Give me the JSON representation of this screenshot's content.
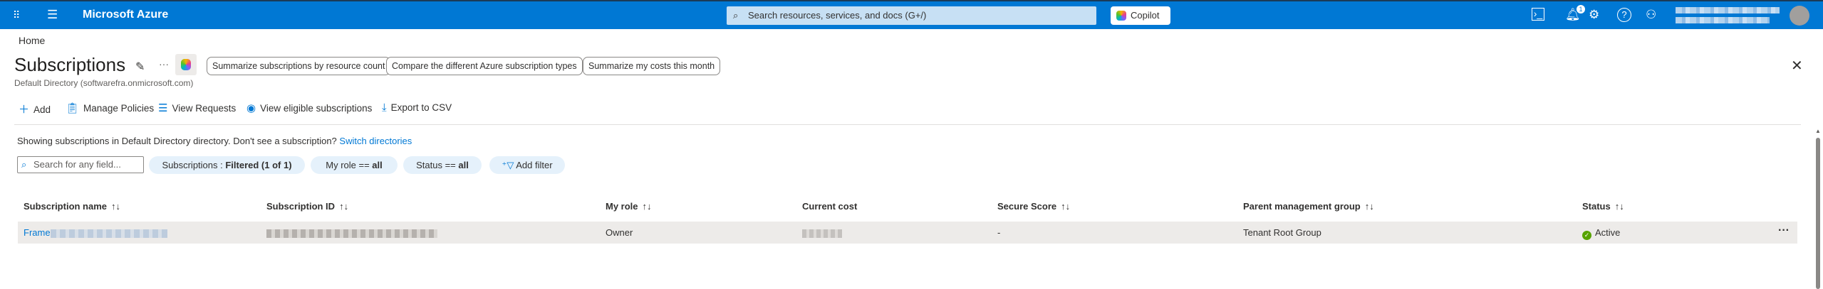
{
  "topbar": {
    "brand": "Microsoft Azure",
    "search_placeholder": "Search resources, services, and docs (G+/)",
    "copilot_label": "Copilot",
    "notification_count": "1"
  },
  "breadcrumb": {
    "home": "Home"
  },
  "page": {
    "title": "Subscriptions",
    "subtitle": "Default Directory (softwarefra.onmicrosoft.com)",
    "more": "···"
  },
  "prompts": [
    "Summarize subscriptions by resource count",
    "Compare the different Azure subscription types",
    "Summarize my costs this month"
  ],
  "commands": {
    "add": "Add",
    "manage_policies": "Manage Policies",
    "view_requests": "View Requests",
    "view_eligible": "View eligible subscriptions",
    "export": "Export to CSV"
  },
  "info": {
    "text": "Showing subscriptions in Default Directory directory. Don't see a subscription?",
    "link": "Switch directories"
  },
  "filters": {
    "search_placeholder": "Search for any field...",
    "subscriptions_label": "Subscriptions : ",
    "subscriptions_value": "Filtered (1 of 1)",
    "role_label": "My role == ",
    "role_value": "all",
    "status_label": "Status == ",
    "status_value": "all",
    "add_filter": "Add filter"
  },
  "table": {
    "columns": [
      "Subscription name",
      "Subscription ID",
      "My role",
      "Current cost",
      "Secure Score",
      "Parent management group",
      "Status"
    ],
    "sort_glyph": "↑↓",
    "rows": [
      {
        "name": "Frame",
        "role": "Owner",
        "secure_score": "-",
        "parent": "Tenant Root Group",
        "status": "Active"
      }
    ]
  },
  "colors": {
    "accent": "#0078d4",
    "active": "#57a300"
  }
}
